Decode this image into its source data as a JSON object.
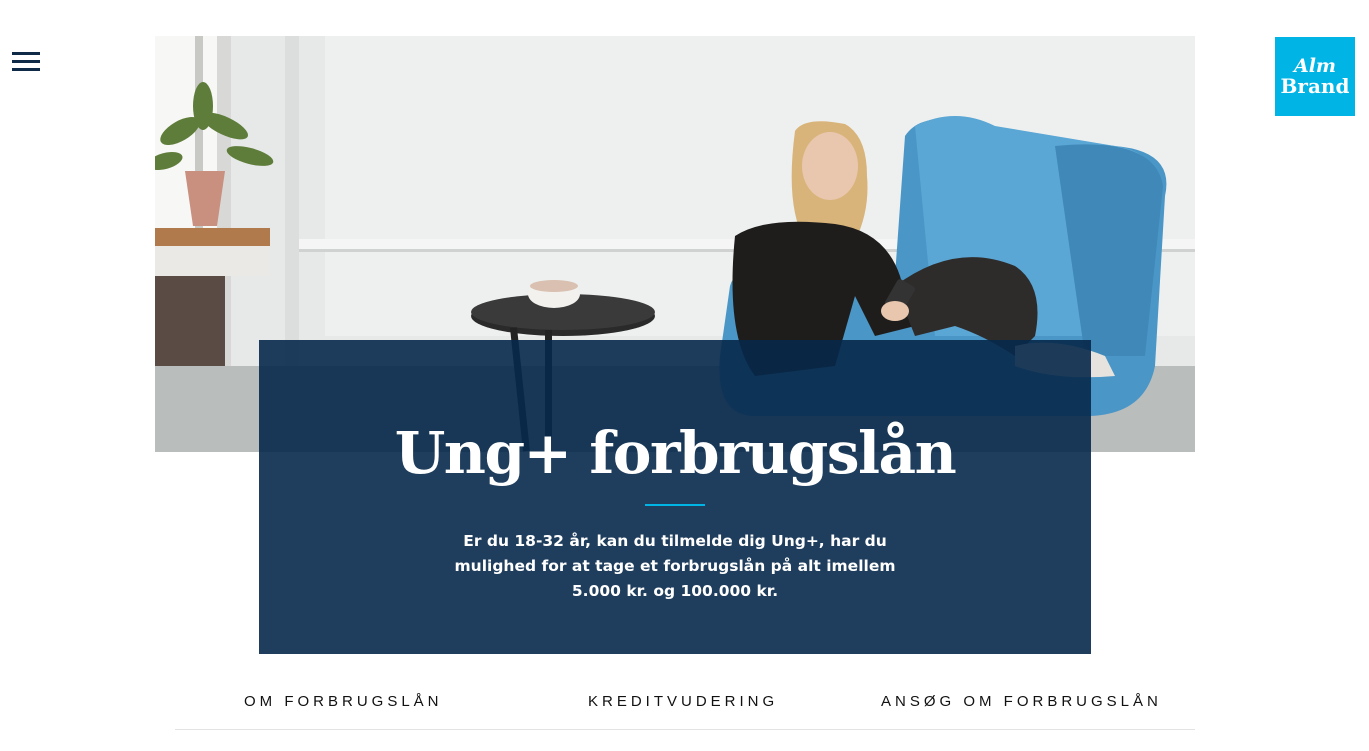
{
  "header": {
    "menu_icon": "hamburger-menu-icon",
    "logo": {
      "line1": "Alm",
      "line2": "Brand",
      "color": "#00b4e6"
    }
  },
  "hero": {
    "image": "photo-young-woman-in-blue-armchair-with-phone",
    "title": "Ung+ forbrugslån",
    "description": "Er du 18-32 år, kan du tilmelde dig Ung+, har du mulighed for at tage et forbrugslån på alt imellem 5.000 kr. og 100.000 kr.",
    "card_color": "#07284a",
    "accent_color": "#00b4e6"
  },
  "subnav": {
    "items": [
      {
        "label": "OM FORBRUGSLÅN"
      },
      {
        "label": "KREDITVUDERING"
      },
      {
        "label": "ANSØG OM FORBRUGSLÅN"
      }
    ]
  }
}
